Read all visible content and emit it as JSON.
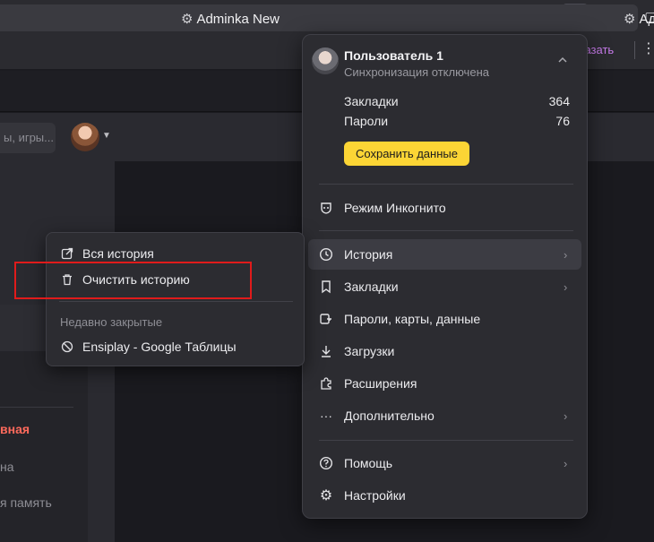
{
  "window": {
    "menu_icon": "hamburger-icon",
    "minimize_icon": "minimize-icon",
    "maximize_icon": "maximize-icon"
  },
  "addressbar": {
    "tell_link": "сказать"
  },
  "page": {
    "site_title_1": "Adminka New",
    "site_title_2": "Ад",
    "search_placeholder": "ы, игры...",
    "nav_active": "вная",
    "nav_item_2": "на",
    "nav_item_3": "я память"
  },
  "main_menu": {
    "user_name": "Пользователь 1",
    "sync_status": "Синхронизация отключена",
    "stats": [
      {
        "label": "Закладки",
        "value": "364"
      },
      {
        "label": "Пароли",
        "value": "76"
      }
    ],
    "save_button": "Сохранить данные",
    "items": [
      {
        "label": "Режим Инкогнито",
        "icon": "incognito-icon"
      },
      {
        "label": "История",
        "icon": "clock-icon"
      },
      {
        "label": "Закладки",
        "icon": "bookmark-icon"
      },
      {
        "label": "Пароли, карты, данные",
        "icon": "key-card-icon"
      },
      {
        "label": "Загрузки",
        "icon": "download-icon"
      },
      {
        "label": "Расширения",
        "icon": "puzzle-icon"
      },
      {
        "label": "Дополнительно",
        "icon": "more-icon"
      },
      {
        "label": "Помощь",
        "icon": "help-icon"
      },
      {
        "label": "Настройки",
        "icon": "gear-icon"
      }
    ]
  },
  "history_submenu": {
    "all_history": "Вся история",
    "clear_history": "Очистить историю",
    "recent_heading": "Недавно закрытые",
    "recent_items": [
      {
        "label": "Ensiplay - Google Таблицы",
        "icon": "blocked-site-icon"
      }
    ]
  },
  "colors": {
    "accent_yellow": "#fcd535",
    "highlight_red": "#e01b1b",
    "link_purple": "#c77bea",
    "active_nav_red": "#ff6a5c"
  }
}
